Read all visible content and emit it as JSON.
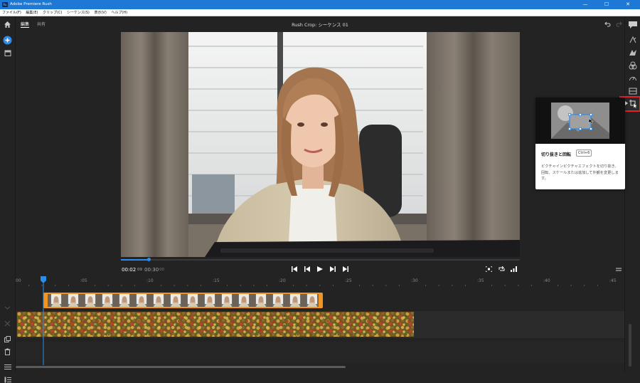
{
  "window": {
    "title": "Adobe Premiere Rush",
    "app_icon_text": "Ru",
    "minimize": "—",
    "maximize": "☐",
    "close": "✕"
  },
  "menu": [
    "ファイル(F)",
    "編集(E)",
    "クリップ(C)",
    "シーケンス(S)",
    "表示(V)",
    "ヘルプ(H)"
  ],
  "header": {
    "tabs": [
      "編集",
      "共有"
    ],
    "project_title": "Rush Crop: シーケンス 01"
  },
  "player": {
    "current_time": "00:02",
    "current_frames": "09",
    "total_time": "00:30",
    "total_frames": "00",
    "progress": 0.07
  },
  "tooltip": {
    "title": "切り抜きと回転",
    "shortcut": "Ctrl+6",
    "description": "ピクチャインピクチャエフェクトを切り抜き、回転、スケールまたは追加して外観を変更します。"
  },
  "timeline": {
    "ruler_labels": [
      "00",
      ":05",
      ":10",
      ":15",
      ":20",
      ":25",
      ":30",
      ":35",
      ":40",
      ":45"
    ],
    "playhead_time": "00:02"
  },
  "colors": {
    "accent": "#2d8ceb",
    "clip_border": "#f39320",
    "highlight": "#e8202a",
    "titlebar": "#1e79d6"
  }
}
